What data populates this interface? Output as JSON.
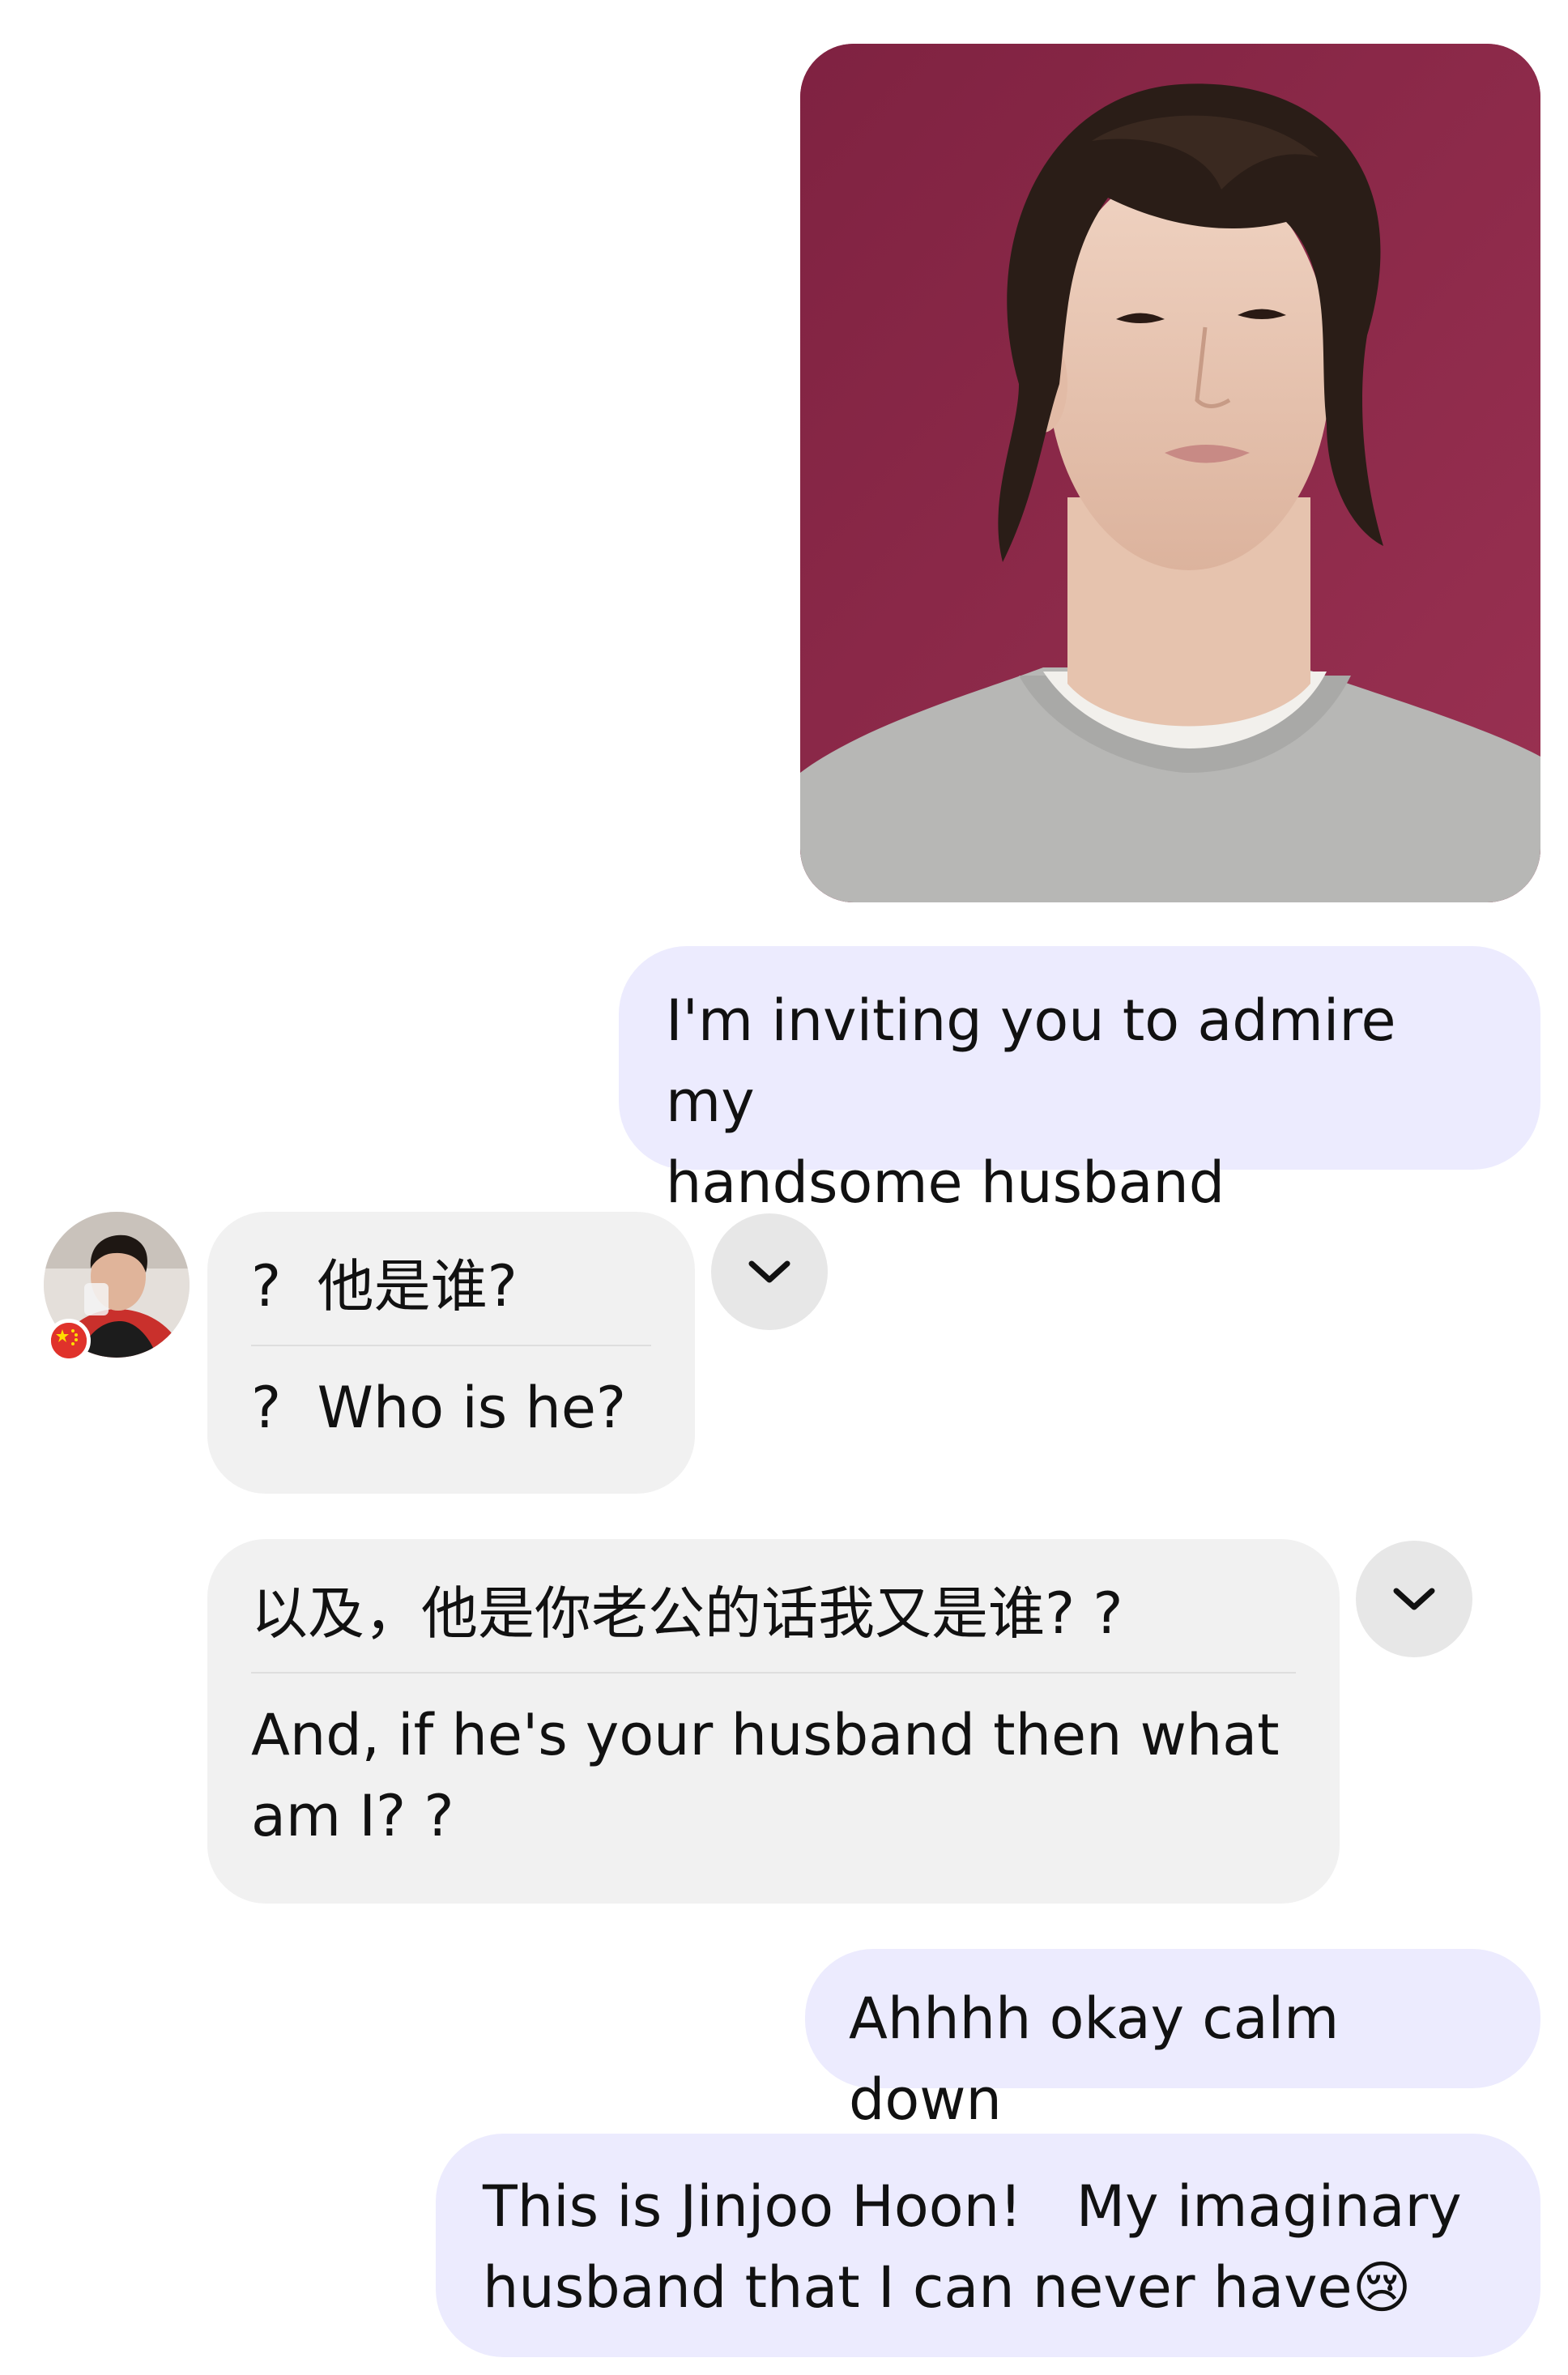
{
  "conversation": {
    "messages": [
      {
        "id": "photo",
        "direction": "outgoing",
        "type": "image",
        "image_description_icon": "photo-icon"
      },
      {
        "id": "msg1",
        "direction": "outgoing",
        "type": "text",
        "text": "I'm inviting you to admire my\nhandsome husband"
      },
      {
        "id": "msg2",
        "direction": "incoming",
        "type": "translated",
        "original": "?  他是谁?",
        "translation": "?  Who is he?",
        "toggle_icon": "chevron-down-icon"
      },
      {
        "id": "msg3",
        "direction": "incoming",
        "type": "translated",
        "original": "以及，他是你老公的话我又是谁? ?",
        "translation": "And, if he's your husband then what\nam I? ?",
        "toggle_icon": "chevron-down-icon"
      },
      {
        "id": "msg4",
        "direction": "outgoing",
        "type": "text",
        "text": "Ahhhh okay calm down"
      },
      {
        "id": "msg5",
        "direction": "outgoing",
        "type": "text",
        "text": "This is Jinjoo Hoon!   My imaginary\nhusband that I can never have😢"
      }
    ]
  },
  "colors": {
    "outgoing_bubble": "#ecebfe",
    "incoming_bubble": "#f1f1f1",
    "toggle_button": "#e7e7e7",
    "photo_background": "#8e2a47"
  }
}
